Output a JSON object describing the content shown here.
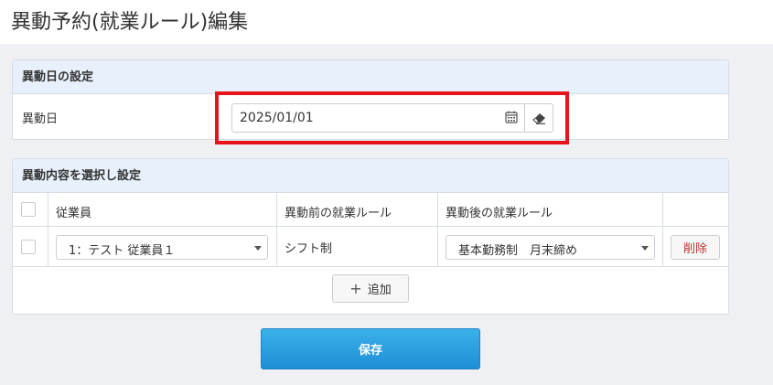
{
  "page": {
    "title": "異動予約(就業ルール)編集"
  },
  "section1": {
    "heading": "異動日の設定",
    "date_label": "異動日",
    "date_value": "2025/01/01",
    "calendar_icon": "calendar-icon",
    "clear_icon": "eraser-icon"
  },
  "section2": {
    "heading": "異動内容を選択し設定",
    "columns": [
      "",
      "従業員",
      "異動前の就業ルール",
      "異動後の就業ルール",
      ""
    ],
    "rows": [
      {
        "employee": "1：テスト 従業員１",
        "before_rule": "シフト制",
        "after_rule": "基本勤務制　月末締め",
        "delete_label": "削除"
      }
    ],
    "add_label": "追加"
  },
  "save_label": "保存",
  "colors": {
    "accent": "#2a9ee0",
    "highlight": "#e8141b",
    "delete_text": "#c0302f",
    "panel_head": "#e8f1fb"
  }
}
